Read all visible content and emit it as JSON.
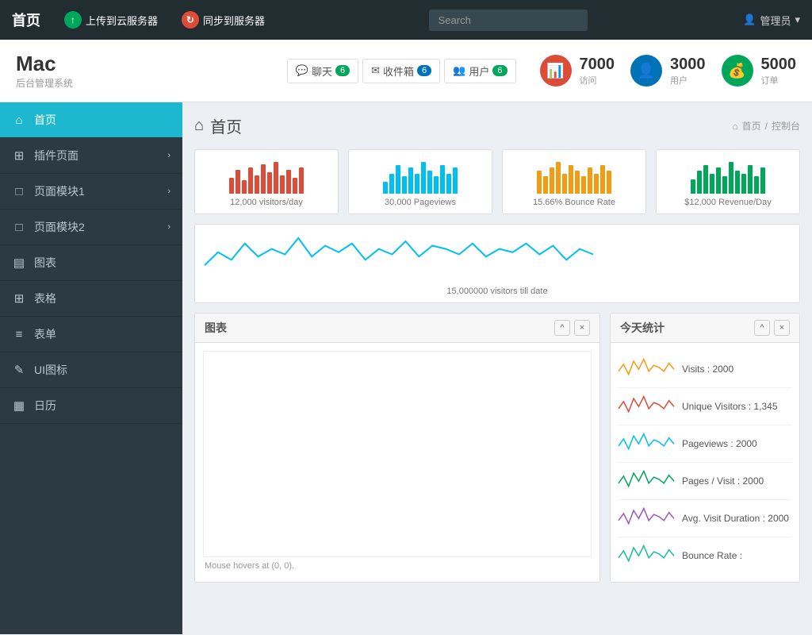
{
  "topnav": {
    "brand": "首页",
    "upload_btn": "上传到云服务器",
    "sync_btn": "同步到服务器",
    "search_placeholder": "Search",
    "admin_label": "管理员"
  },
  "header": {
    "title": "Mac",
    "subtitle": "后台管理系统",
    "chat_label": "聊天",
    "chat_count": "6",
    "inbox_label": "收件箱",
    "inbox_count": "6",
    "users_label": "用户",
    "users_count": "6",
    "stat1_num": "7000",
    "stat1_label": "访问",
    "stat2_num": "3000",
    "stat2_label": "用户",
    "stat3_num": "5000",
    "stat3_label": "订单"
  },
  "sidebar": {
    "items": [
      {
        "label": "首页",
        "icon": "⌂",
        "active": true
      },
      {
        "label": "插件页面",
        "icon": "▦",
        "arrow": true
      },
      {
        "label": "页面模块1",
        "icon": "▢",
        "arrow": true
      },
      {
        "label": "页面模块2",
        "icon": "▢",
        "arrow": true
      },
      {
        "label": "图表",
        "icon": "▤"
      },
      {
        "label": "表格",
        "icon": "▦"
      },
      {
        "label": "表单",
        "icon": "≡"
      },
      {
        "label": "UI图标",
        "icon": "✎"
      },
      {
        "label": "日历",
        "icon": "▦"
      }
    ]
  },
  "breadcrumb": {
    "page_title": "首页",
    "home": "首页",
    "separator": "/",
    "current": "控制台"
  },
  "stat_cards": [
    {
      "label": "12,000 visitors/day",
      "color": "#dd4b39",
      "bars": [
        30,
        45,
        25,
        50,
        35,
        55,
        40,
        60,
        35,
        45,
        30,
        50
      ]
    },
    {
      "label": "30,000 Pageviews",
      "color": "#00c0ef",
      "bars": [
        20,
        35,
        50,
        30,
        45,
        35,
        55,
        40,
        30,
        50,
        35,
        45
      ]
    },
    {
      "label": "15.66% Bounce Rate",
      "color": "#f39c12",
      "bars": [
        40,
        30,
        45,
        55,
        35,
        50,
        40,
        30,
        45,
        35,
        50,
        40
      ]
    },
    {
      "label": "$12,000 Revenue/Day",
      "color": "#00a65a",
      "bars": [
        25,
        40,
        50,
        35,
        45,
        30,
        55,
        40,
        35,
        50,
        30,
        45
      ]
    }
  ],
  "sparkline_card": {
    "label": "15,000000 visitors till date"
  },
  "chart_panel": {
    "title": "图表",
    "minimize_label": "^",
    "close_label": "×",
    "mouse_info": "Mouse hovers at (0, 0)."
  },
  "today_panel": {
    "title": "今天统计",
    "stats": [
      {
        "label": "Visits : 2000"
      },
      {
        "label": "Unique Visitors : 1,345"
      },
      {
        "label": "Pageviews : 2000"
      },
      {
        "label": "Pages / Visit : 2000"
      },
      {
        "label": "Avg. Visit Duration : 2000"
      },
      {
        "label": "Bounce Rate :"
      }
    ]
  }
}
